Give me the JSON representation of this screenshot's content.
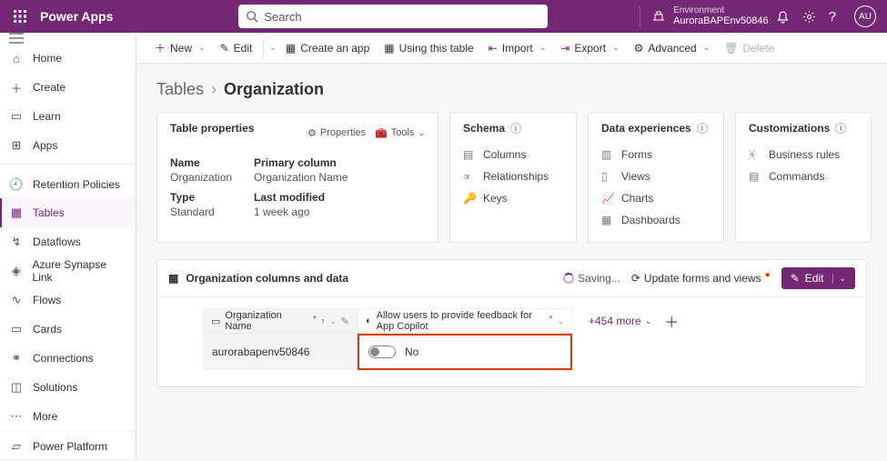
{
  "topbar": {
    "brand": "Power Apps",
    "search_placeholder": "Search",
    "env_label": "Environment",
    "env_name": "AuroraBAPEnv50846",
    "avatar": "AU"
  },
  "sidebar": {
    "items": [
      {
        "label": "Home"
      },
      {
        "label": "Create"
      },
      {
        "label": "Learn"
      },
      {
        "label": "Apps"
      },
      {
        "label": "Retention Policies"
      },
      {
        "label": "Tables"
      },
      {
        "label": "Dataflows"
      },
      {
        "label": "Azure Synapse Link"
      },
      {
        "label": "Flows"
      },
      {
        "label": "Cards"
      },
      {
        "label": "Connections"
      },
      {
        "label": "Solutions"
      },
      {
        "label": "More"
      }
    ],
    "bottom": {
      "label": "Power Platform"
    }
  },
  "cmd": {
    "new": "New",
    "edit": "Edit",
    "create_app": "Create an app",
    "using_table": "Using this table",
    "import": "Import",
    "export": "Export",
    "advanced": "Advanced",
    "delete": "Delete"
  },
  "crumb": {
    "parent": "Tables",
    "current": "Organization"
  },
  "tableprops": {
    "title": "Table properties",
    "properties_btn": "Properties",
    "tools_btn": "Tools",
    "name_k": "Name",
    "name_v": "Organization",
    "type_k": "Type",
    "type_v": "Standard",
    "pc_k": "Primary column",
    "pc_v": "Organization Name",
    "lm_k": "Last modified",
    "lm_v": "1 week ago"
  },
  "schema": {
    "title": "Schema",
    "columns": "Columns",
    "rel": "Relationships",
    "keys": "Keys"
  },
  "dataexp": {
    "title": "Data experiences",
    "forms": "Forms",
    "views": "Views",
    "charts": "Charts",
    "dash": "Dashboards"
  },
  "custom": {
    "title": "Customizations",
    "rules": "Business rules",
    "cmds": "Commands"
  },
  "section2": {
    "title": "Organization columns and data",
    "saving": "Saving...",
    "update": "Update forms and views",
    "edit": "Edit",
    "col1": "Organization Name",
    "col2": "Allow users to provide feedback for App Copilot",
    "more": "+454 more",
    "row_name": "aurorabapenv50846",
    "row_toggle": "No"
  }
}
